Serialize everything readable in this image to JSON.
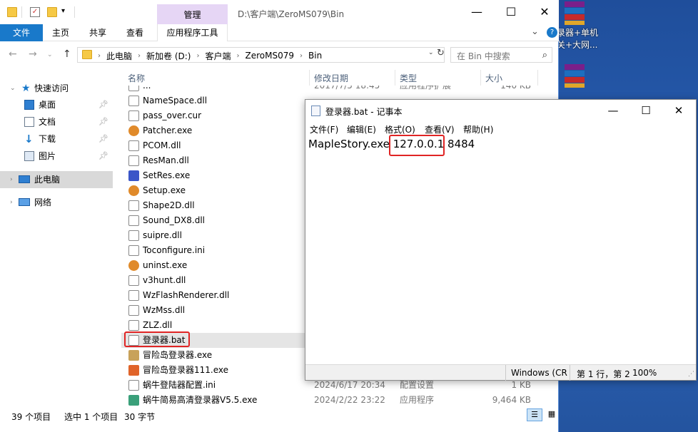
{
  "explorer": {
    "context_tab": "管理",
    "window_title": "D:\\客户端\\ZeroMS079\\Bin",
    "ribbon_tabs": [
      "文件",
      "主页",
      "共享",
      "查看",
      "应用程序工具"
    ],
    "address": [
      "此电脑",
      "新加卷 (D:)",
      "客户端",
      "ZeroMS079",
      "Bin"
    ],
    "search_placeholder": "在 Bin 中搜索",
    "nav": {
      "quick_access": "快速访问",
      "desktop": "桌面",
      "documents": "文档",
      "downloads": "下载",
      "pictures": "图片",
      "this_pc": "此电脑",
      "network": "网络"
    },
    "headers": {
      "name": "名称",
      "date": "修改日期",
      "type": "类型",
      "size": "大小"
    },
    "partial_row": {
      "name": "...",
      "date": "2017/7/5 18:45",
      "type": "应用程序扩展",
      "size": "140 KB"
    },
    "files": [
      {
        "name": "NameSpace.dll",
        "icon": "dll-file-icon"
      },
      {
        "name": "pass_over.cur",
        "icon": "cursor-file-icon"
      },
      {
        "name": "Patcher.exe",
        "icon": "maple-app-icon"
      },
      {
        "name": "PCOM.dll",
        "icon": "dll-file-icon"
      },
      {
        "name": "ResMan.dll",
        "icon": "dll-file-icon"
      },
      {
        "name": "SetRes.exe",
        "icon": "setres-app-icon"
      },
      {
        "name": "Setup.exe",
        "icon": "maple-app-icon"
      },
      {
        "name": "Shape2D.dll",
        "icon": "dll-file-icon"
      },
      {
        "name": "Sound_DX8.dll",
        "icon": "dll-file-icon"
      },
      {
        "name": "suipre.dll",
        "icon": "dll-file-icon"
      },
      {
        "name": "Toconfigure.ini",
        "icon": "ini-file-icon"
      },
      {
        "name": "uninst.exe",
        "icon": "maple-app-icon"
      },
      {
        "name": "v3hunt.dll",
        "icon": "dll-file-icon"
      },
      {
        "name": "WzFlashRenderer.dll",
        "icon": "dll-file-icon"
      },
      {
        "name": "WzMss.dll",
        "icon": "dll-file-icon"
      },
      {
        "name": "ZLZ.dll",
        "icon": "dll-file-icon"
      },
      {
        "name": "登录器.bat",
        "icon": "bat-file-icon",
        "selected": true
      },
      {
        "name": "冒险岛登录器.exe",
        "icon": "launcher-app-icon"
      },
      {
        "name": "冒险岛登录器111.exe",
        "icon": "fox-app-icon"
      },
      {
        "name": "蜗牛登陆器配置.ini",
        "icon": "ini-file-icon",
        "date": "2024/6/17 20:34",
        "type": "配置设置",
        "size": "1 KB"
      },
      {
        "name": "蜗牛简易高清登录器V5.5.exe",
        "icon": "snail-app-icon",
        "date": "2024/2/22 23:22",
        "type": "应用程序",
        "size": "9,464 KB"
      }
    ],
    "status": {
      "count": "39 个项目",
      "selected": "选中 1 个项目",
      "size": "30 字节"
    }
  },
  "notepad": {
    "title": "登录器.bat - 记事本",
    "menu": [
      "文件(F)",
      "编辑(E)",
      "格式(O)",
      "查看(V)",
      "帮助(H)"
    ],
    "text_before": "MapleStory.exe ",
    "text_ip": "127.0.0.1",
    "text_after": " 8484",
    "status": {
      "encoding": "Windows (CR",
      "position": "第 1 行，第 2",
      "zoom": "100%"
    }
  },
  "desktop": {
    "label_line1": "录器+单机",
    "label_line2": "关+大网..."
  },
  "colors": {
    "file_tab": "#1979ca",
    "context_tab": "#e6d6f5",
    "highlight": "#e02424",
    "selection": "#e5e5e5"
  }
}
